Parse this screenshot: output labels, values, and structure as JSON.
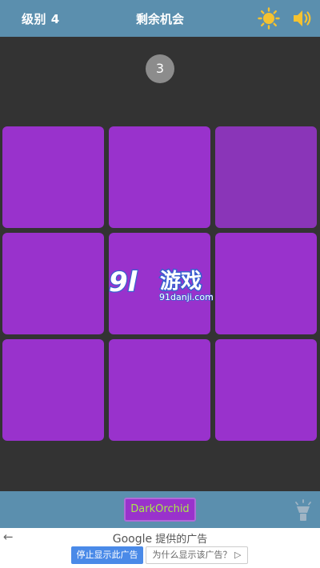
{
  "header": {
    "level_label": "级别 4",
    "chances_label": "剩余机会",
    "icons": {
      "brightness": "sun-icon",
      "sound": "speaker-icon"
    }
  },
  "counter": {
    "value": "3"
  },
  "board": {
    "rows": 3,
    "cols": 3,
    "base_color": "#9932cc",
    "odd_color": "#8a35b8",
    "odd_index": 2
  },
  "watermark": {
    "logo": "9l",
    "title": "游戏",
    "site": "91danji.com"
  },
  "footer": {
    "target_color_name": "DarkOrchid",
    "hint_icon": "lightbulb-icon"
  },
  "ad": {
    "back_glyph": "←",
    "brand": "Google",
    "provider_text": "提供的广告",
    "stop_label": "停止显示此广告",
    "why_label": "为什么显示该广告？ ▷"
  },
  "colors": {
    "header_bg": "#5b8fae",
    "board_bg": "#333333",
    "counter_bg": "#8c8c8c",
    "target_text": "#a8e84a"
  }
}
